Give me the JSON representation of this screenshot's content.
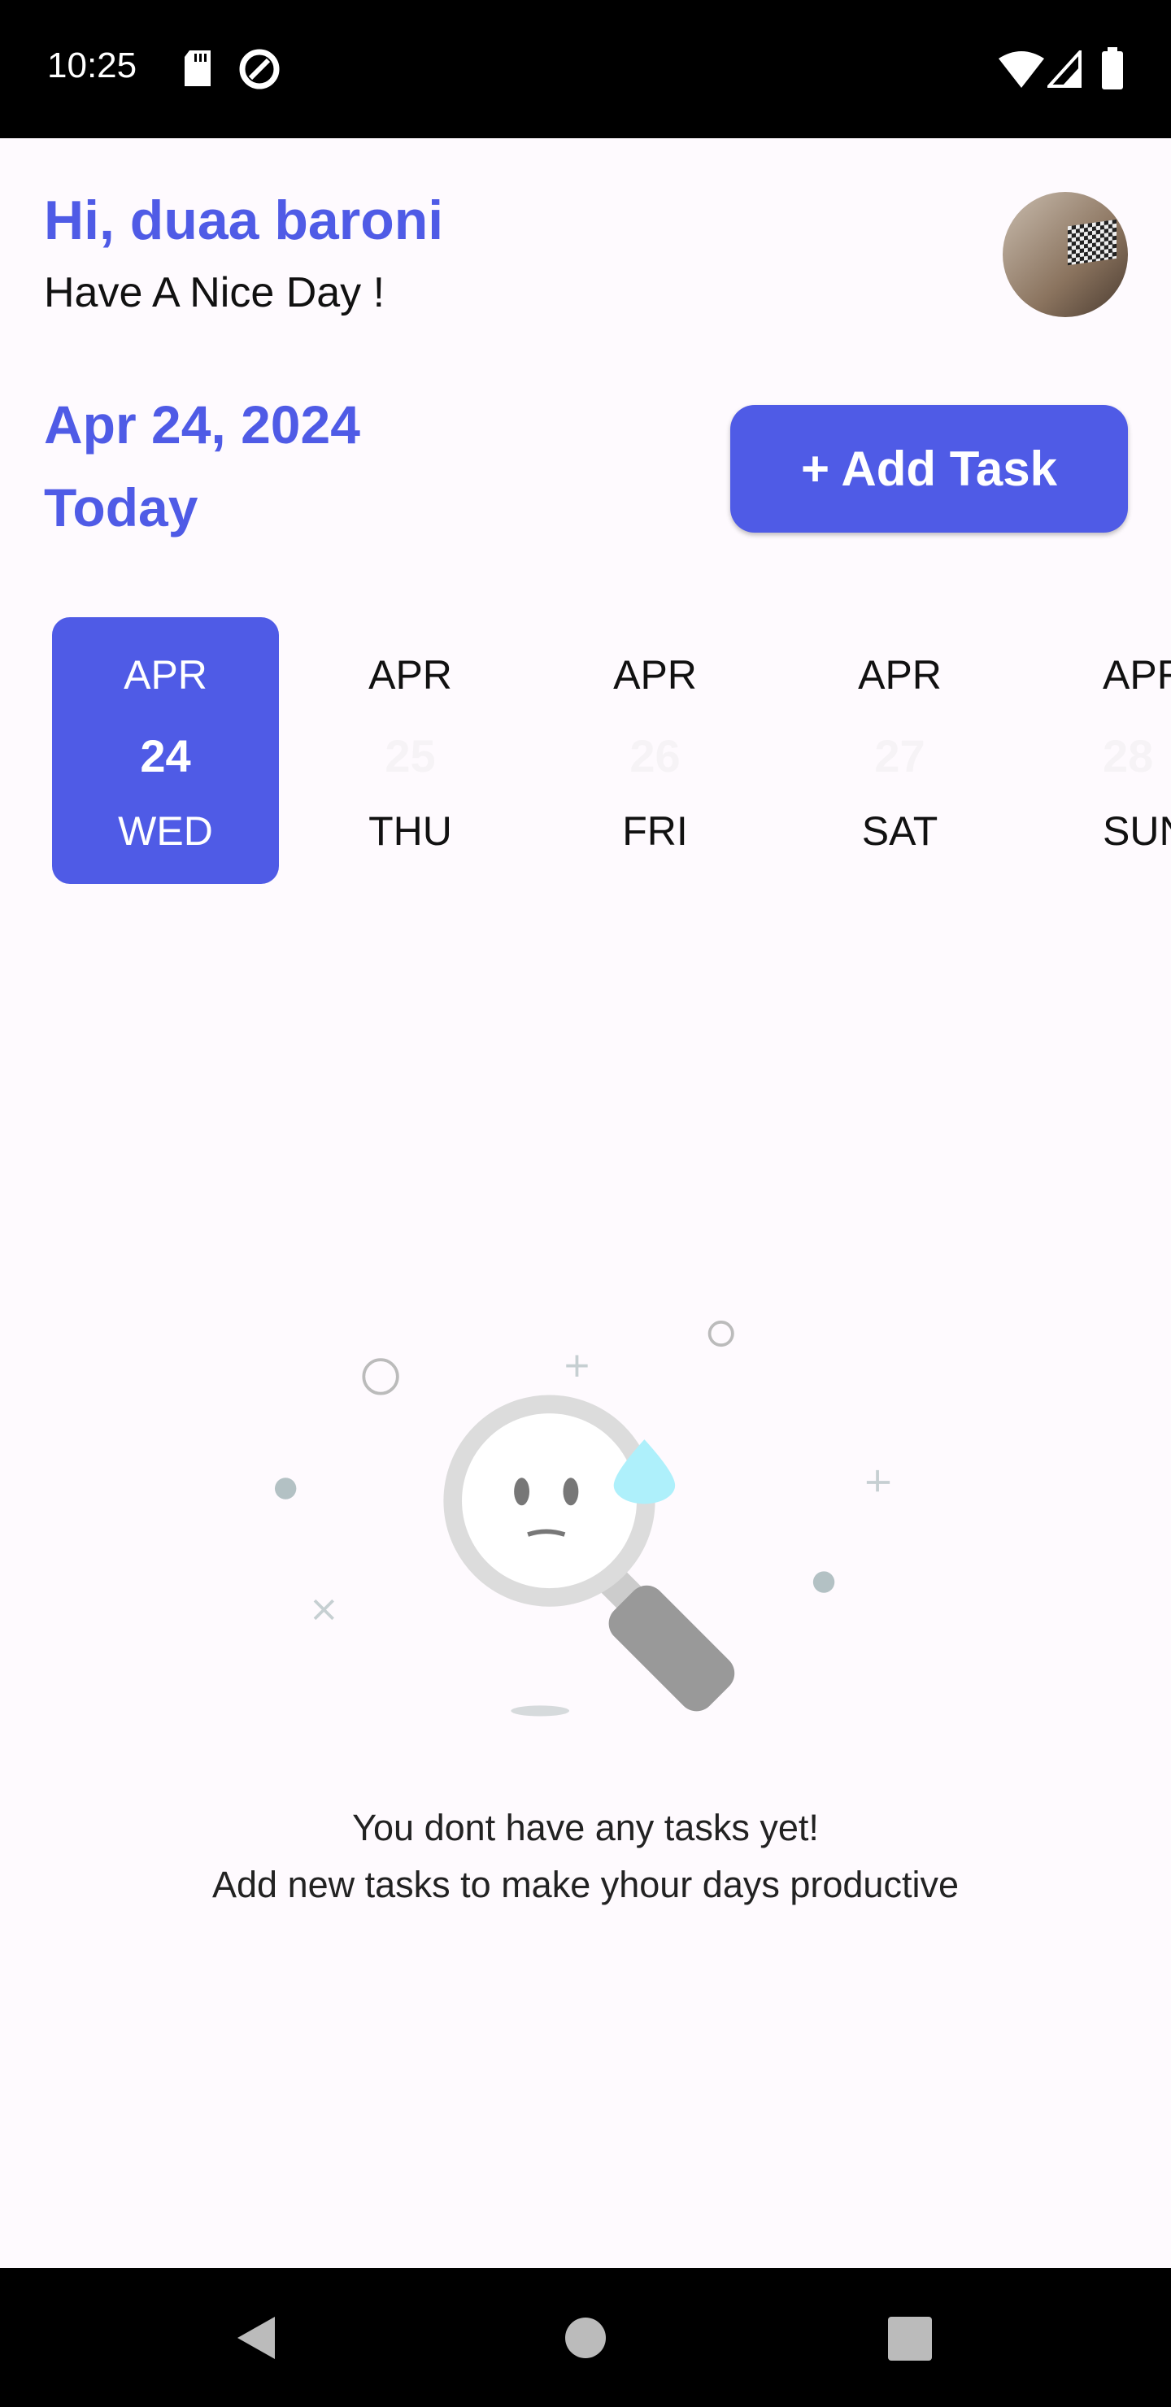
{
  "status_bar": {
    "time": "10:25",
    "icons": [
      "sd-card-icon",
      "data-saver-icon",
      "wifi-icon",
      "signal-icon",
      "battery-icon"
    ]
  },
  "header": {
    "greeting": "Hi, duaa baroni",
    "subtitle": "Have A Nice Day !"
  },
  "date_section": {
    "date": "Apr 24, 2024",
    "label": "Today",
    "add_button": "+ Add Task"
  },
  "calendar": [
    {
      "month": "APR",
      "day": "24",
      "weekday": "WED",
      "selected": true
    },
    {
      "month": "APR",
      "day": "25",
      "weekday": "THU",
      "selected": false
    },
    {
      "month": "APR",
      "day": "26",
      "weekday": "FRI",
      "selected": false
    },
    {
      "month": "APR",
      "day": "27",
      "weekday": "SAT",
      "selected": false
    },
    {
      "month": "APR",
      "day": "28",
      "weekday": "SUN",
      "selected": false
    }
  ],
  "empty_state": {
    "line1": "You dont have any tasks yet!",
    "line2": "Add new tasks to make yhour days productive"
  },
  "colors": {
    "accent": "#4f5be6",
    "background": "#fefafe"
  }
}
